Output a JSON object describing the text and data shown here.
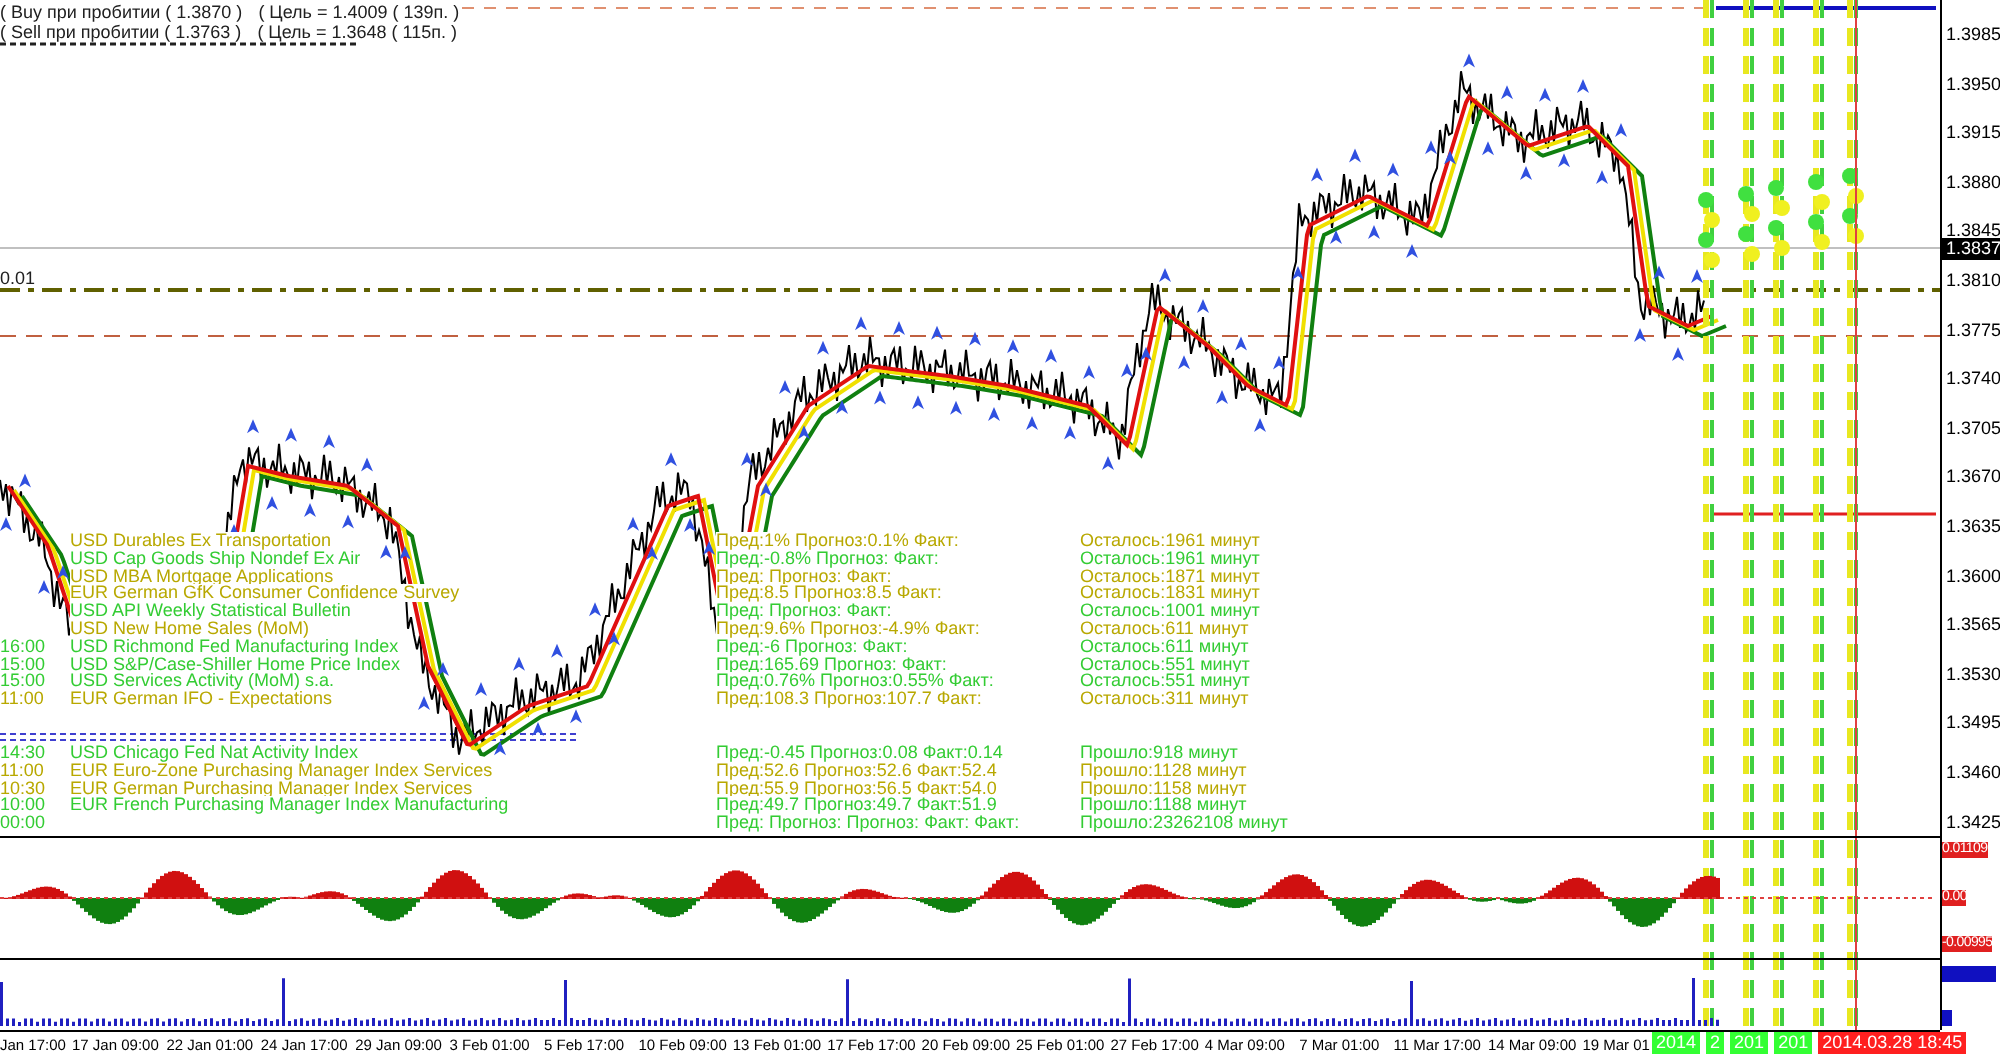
{
  "signals": [
    {
      "label": "( Buy при пробитии ( 1.3870 )",
      "target": "( Цель = 1.4009 ( 139п. )"
    },
    {
      "label": "( Sell  при пробитии ( 1.3763 )",
      "target": "( Цель = 1.3648 ( 115п. )"
    }
  ],
  "left_level": "0.01",
  "price_axis": {
    "ticks": [
      "1.3985",
      "1.3950",
      "1.3915",
      "1.3880",
      "1.3845",
      "1.3810",
      "1.3775",
      "1.3740",
      "1.3705",
      "1.3670",
      "1.3635",
      "1.3600",
      "1.3565",
      "1.3530",
      "1.3495",
      "1.3460",
      "1.3425"
    ],
    "current": "1.3837"
  },
  "events_upcoming": [
    {
      "name": "USD Durables Ex Transportation",
      "values": "Пред:1% Прогноз:0.1% Факт:",
      "countdown": "Осталось:1961 минут",
      "color": "#b8a800"
    },
    {
      "name": "USD Cap Goods Ship Nondef Ex Air",
      "values": "Пред:-0.8% Прогноз: Факт:",
      "countdown": "Осталось:1961 минут",
      "color": "#33cc33"
    },
    {
      "name": "USD MBA Mortgage Applications",
      "values": "Пред: Прогноз: Факт:",
      "countdown": "Осталось:1871 минут",
      "color": "#b8a800"
    },
    {
      "name": "EUR German GfK Consumer Confidence Survey",
      "values": "Пред:8.5 Прогноз:8.5 Факт:",
      "countdown": "Осталось:1831 минут",
      "color": "#b8a800"
    },
    {
      "name": "USD API Weekly Statistical Bulletin",
      "values": "Пред: Прогноз: Факт:",
      "countdown": "Осталось:1001 минут",
      "color": "#33cc33"
    },
    {
      "name": "USD New Home Sales (MoM)",
      "values": "Пред:9.6% Прогноз:-4.9% Факт:",
      "countdown": "Осталось:611 минут",
      "color": "#b8a800"
    },
    {
      "time": "16:00",
      "name": "USD Richmond Fed Manufacturing Index",
      "values": "Пред:-6 Прогноз: Факт:",
      "countdown": "Осталось:611 минут",
      "color": "#33cc33"
    },
    {
      "time": "15:00",
      "name": "USD S&P/Case-Shiller Home Price Index",
      "values": "Пред:165.69 Прогноз: Факт:",
      "countdown": "Осталось:551 минут",
      "color": "#33cc33"
    },
    {
      "time": "15:00",
      "name": "USD Services Activity (MoM) s.a.",
      "values": "Пред:0.76% Прогноз:0.55% Факт:",
      "countdown": "Осталось:551 минут",
      "color": "#33cc33"
    },
    {
      "time": "11:00",
      "name": "EUR German IFO - Expectations",
      "values": "Пред:108.3 Прогноз:107.7 Факт:",
      "countdown": "Осталось:311 минут",
      "color": "#b8a800"
    }
  ],
  "events_past": [
    {
      "time": "14:30",
      "name": "USD Chicago Fed Nat Activity Index",
      "values": "Пред:-0.45 Прогноз:0.08 Факт:0.14",
      "countdown": "Прошло:918 минут",
      "color": "#33cc33"
    },
    {
      "time": "11:00",
      "name": "EUR Euro-Zone Purchasing Manager Index Services",
      "values": "Пред:52.6 Прогноз:52.6 Факт:52.4",
      "countdown": "Прошло:1128 минут",
      "color": "#b8a800"
    },
    {
      "time": "10:30",
      "name": "EUR German Purchasing Manager Index Services",
      "values": "Пред:55.9 Прогноз:56.5 Факт:54.0",
      "countdown": "Прошло:1158 минут",
      "color": "#b8a800"
    },
    {
      "time": "10:00",
      "name": "EUR French Purchasing Manager Index Manufacturing",
      "values": "Пред:49.7 Прогноз:49.7 Факт:51.9",
      "countdown": "Прошло:1188 минут",
      "color": "#33cc33"
    },
    {
      "time": "00:00",
      "values": "Пред: Прогноз: Прогноз: Факт: Факт:",
      "countdown": "Прошло:23262108 минут",
      "color": "#33cc33"
    }
  ],
  "oscillator_axis": [
    "0.01109",
    "0.00",
    "-0.00995"
  ],
  "time_axis": [
    "Jan 17:00",
    "17 Jan 09:00",
    "22 Jan 01:00",
    "24 Jan 17:00",
    "29 Jan 09:00",
    "3 Feb 01:00",
    "5 Feb 17:00",
    "10 Feb 09:00",
    "13 Feb 01:00",
    "17 Feb 17:00",
    "20 Feb 09:00",
    "25 Feb 01:00",
    "27 Feb 17:00",
    "4 Mar 09:00",
    "7 Mar 01:00",
    "11 Mar 17:00",
    "14 Mar 09:00",
    "19 Mar 01"
  ],
  "time_tags": [
    {
      "label": "2014",
      "color": "#33ff33"
    },
    {
      "label": "2",
      "color": "#33ff33"
    },
    {
      "label": "201",
      "color": "#33ff33"
    },
    {
      "label": "201",
      "color": "#33ff33"
    },
    {
      "label": "2014.03.28 18:45",
      "color": "#ff2020"
    }
  ]
}
